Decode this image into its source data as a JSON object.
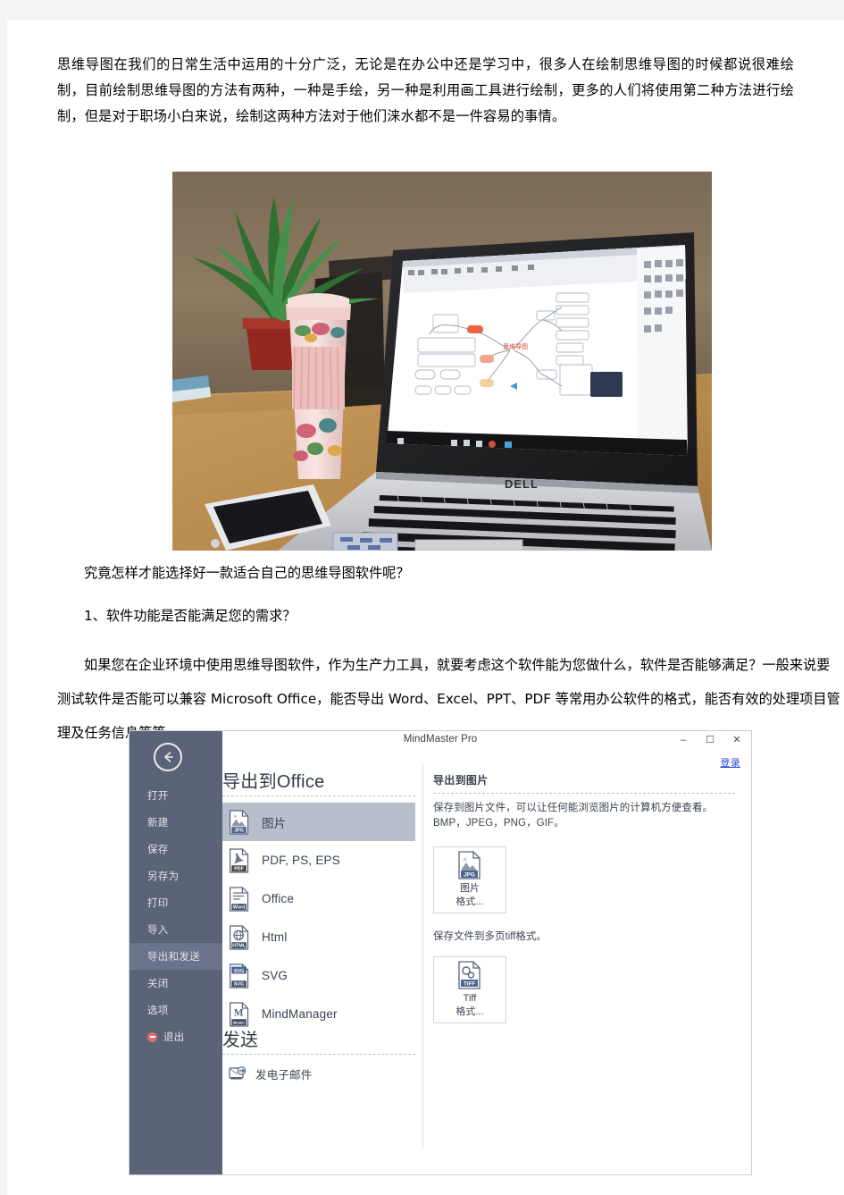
{
  "document": {
    "paragraphs": {
      "intro": "思维导图在我们的日常生活中运用的十分广泛，无论是在办公中还是学习中，很多人在绘制思维导图的时候都说很难绘制，目前绘制思维导图的方法有两种，一种是手绘，另一种是利用画工具进行绘制，更多的人们将使用第二种方法进行绘制，但是对于职场小白来说，绘制这两种方法对于他们涞水都不是一件容易的事情。",
      "question": "究竟怎样才能选择好一款适合自己的思维导图软件呢？",
      "list_item_1": "1、软件功能是否能满足您的需求？",
      "body": "如果您在企业环境中使用思维导图软件，作为生产力工具，就要考虑这个软件能为您做什么，软件是否能够满足？一般来说要测试软件是否能可以兼容 Microsoft Office，能否导出 Word、Excel、PPT、PDF 等常用办公软件的格式，能否有效的处理项目管理及任务信息等等。"
    },
    "photo": {
      "alt_name": "laptop-mindmap-photo",
      "scene": "Dell laptop on wooden desk showing a mind map, with a potted plant, a pink floral travel mug, and a white smartphone",
      "laptop_brand": "DELL"
    }
  },
  "mindmaster": {
    "window_title": "MindMaster Pro",
    "window_buttons": {
      "minimize": "–",
      "maximize": "☐",
      "close": "✕"
    },
    "login_label": "登录",
    "back_icon": "back-arrow-icon",
    "sidebar": [
      {
        "label": "打开",
        "selected": false
      },
      {
        "label": "新建",
        "selected": false
      },
      {
        "label": "保存",
        "selected": false
      },
      {
        "label": "另存为",
        "selected": false
      },
      {
        "label": "打印",
        "selected": false
      },
      {
        "label": "导入",
        "selected": false
      },
      {
        "label": "导出和发送",
        "selected": true
      },
      {
        "label": "关闭",
        "selected": false
      },
      {
        "label": "选项",
        "selected": false
      },
      {
        "label": "退出",
        "selected": false,
        "has_exit_icon": true
      }
    ],
    "center": {
      "export_heading": "导出到Office",
      "formats": [
        {
          "label": "图片",
          "icon": "jpg-file-icon",
          "badge": "JPG",
          "badge_color": "#4d6391",
          "selected": true
        },
        {
          "label": "PDF, PS, EPS",
          "icon": "pdf-file-icon",
          "badge": "PDF",
          "badge_color": "#4a4a4a",
          "selected": false
        },
        {
          "label": "Office",
          "icon": "word-file-icon",
          "badge": "Word",
          "badge_color": "#44506b",
          "selected": false
        },
        {
          "label": "Html",
          "icon": "html-file-icon",
          "badge": "HTML",
          "badge_color": "#44506b",
          "selected": false
        },
        {
          "label": "SVG",
          "icon": "svg-file-icon",
          "badge": "SVG",
          "badge_color": "#44506b",
          "selected": false
        },
        {
          "label": "MindManager",
          "icon": "mindmanager-file-icon",
          "badge": "Minder",
          "badge_color": "#44506b",
          "selected": false
        }
      ],
      "send_heading": "发送",
      "send_items": [
        {
          "label": "发电子邮件",
          "icon": "email-send-icon"
        }
      ]
    },
    "right_panel": {
      "title": "导出到图片",
      "description": "保存到图片文件，可以让任何能浏览图片的计算机方便查看。 BMP，JPEG，PNG，GIF。",
      "card_image": {
        "icon": "jpg-file-icon",
        "badge": "JPG",
        "line1": "图片",
        "line2": "格式..."
      },
      "description2": "保存文件到多页tiff格式。",
      "card_tiff": {
        "icon": "tiff-file-icon",
        "badge": "TIFF",
        "line1": "Tiff",
        "line2": "格式..."
      }
    },
    "colors": {
      "sidebar_bg": "#5a6378",
      "sidebar_selected": "#6b748b",
      "item_selected": "#b8bfcc",
      "link": "#2b46d6",
      "heading": "#333b4a"
    }
  }
}
